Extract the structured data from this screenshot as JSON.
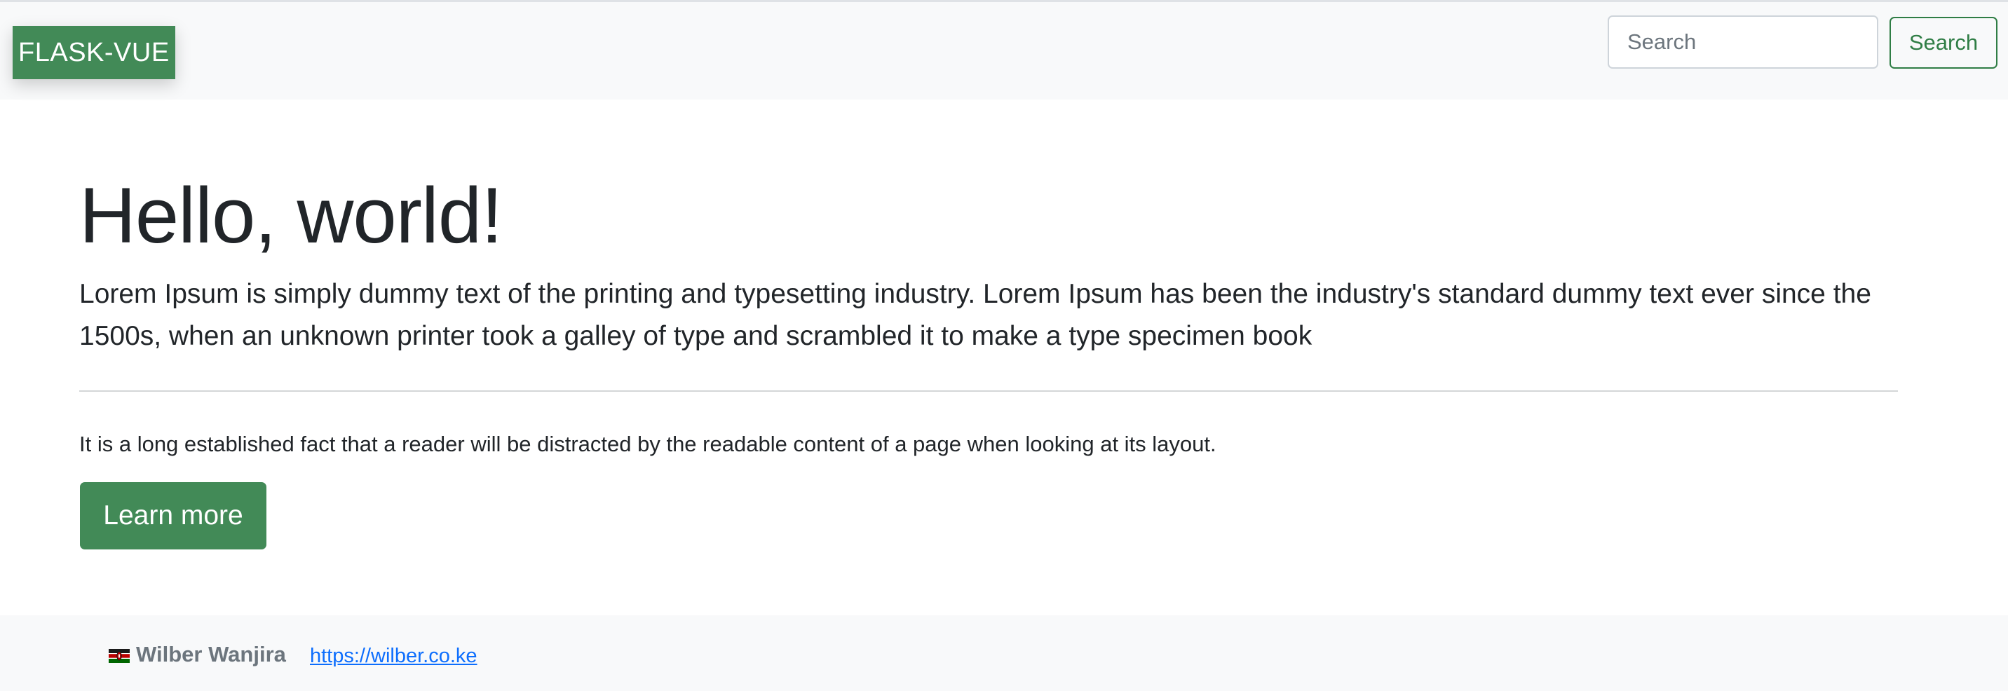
{
  "navbar": {
    "brand": "FLASK-VUE",
    "search_placeholder": "Search",
    "search_button_label": "Search",
    "brand_color": "#428a57",
    "background_color": "#f8f9fa"
  },
  "jumbotron": {
    "title": "Hello, world!",
    "lead": "Lorem Ipsum is simply dummy text of the printing and typesetting industry. Lorem Ipsum has been the industry's standard dummy text ever since the 1500s, when an unknown printer took a galley of type and scrambled it to make a type specimen book",
    "body": "It is a long established fact that a reader will be distracted by the readable content of a page when looking at its layout.",
    "button_label": "Learn more",
    "button_color": "#428a57"
  },
  "footer": {
    "flag_icon": "kenya-flag-icon",
    "author": "Wilber Wanjira",
    "link_text": "https://wilber.co.ke",
    "link_color": "#0d6efd"
  }
}
